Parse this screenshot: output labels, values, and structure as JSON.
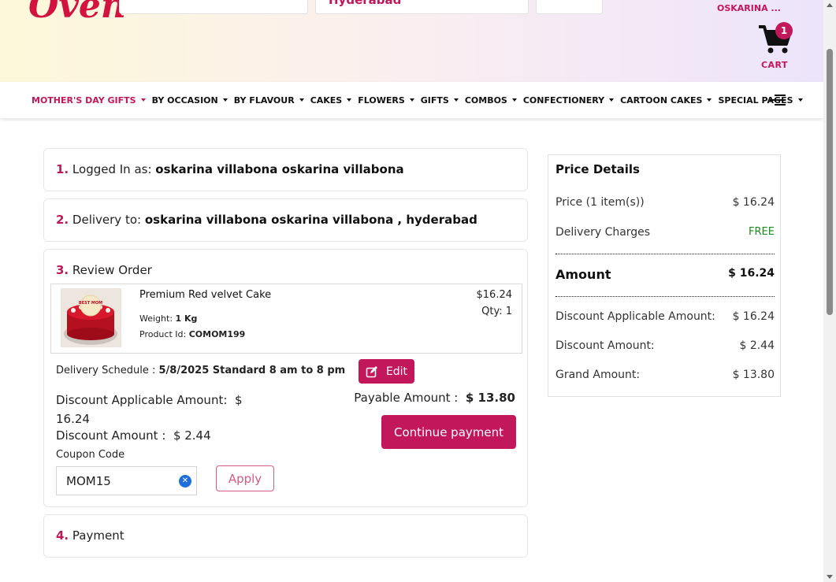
{
  "header": {
    "logo_text": "Oven",
    "location": "Hyderabad",
    "user_name": "OSKARINA ...",
    "cart_label": "CART",
    "cart_count": "1"
  },
  "nav": {
    "items": [
      {
        "label": "MOTHER'S DAY GIFTS"
      },
      {
        "label": "BY OCCASION"
      },
      {
        "label": "BY FLAVOUR"
      },
      {
        "label": "CAKES"
      },
      {
        "label": "FLOWERS"
      },
      {
        "label": "GIFTS"
      },
      {
        "label": "COMBOS"
      },
      {
        "label": "CONFECTIONERY"
      },
      {
        "label": "CARTOON CAKES"
      },
      {
        "label": "SPECIAL PAGES"
      }
    ]
  },
  "steps": {
    "login": {
      "num": "1.",
      "label": "Logged In as:",
      "value": "oskarina villabona oskarina villabona"
    },
    "delivery": {
      "num": "2.",
      "label": "Delivery to:",
      "value": "oskarina villabona oskarina villabona ,  hyderabad"
    },
    "review": {
      "num": "3.",
      "label": "Review Order"
    },
    "payment": {
      "num": "4.",
      "label": "Payment"
    }
  },
  "order": {
    "product_name": "Premium Red velvet Cake",
    "weight_label": "Weight:",
    "weight_value": "1 Kg",
    "product_id_label": "Product Id:",
    "product_id_value": "COMOM199",
    "price": "$16.24",
    "qty": "Qty: 1",
    "cake_topper_text": "BEST MOM",
    "delivery_label": "Delivery Schedule :",
    "delivery_value": "5/8/2025 Standard 8 am to 8 pm",
    "edit_label": "Edit",
    "discount_applicable_label": "Discount Applicable Amount:",
    "discount_applicable_value": "$ 16.24",
    "discount_amount_label": "Discount Amount :",
    "discount_amount_value": "$ 2.44",
    "payable_label": "Payable Amount :",
    "payable_value": "$ 13.80",
    "continue_label": "Continue payment",
    "coupon_label": "Coupon Code",
    "coupon_value": "MOM15",
    "apply_label": "Apply"
  },
  "price_details": {
    "title": "Price Details",
    "rows": [
      {
        "label": "Price (1 item(s))",
        "value": "$ 16.24"
      },
      {
        "label": "Delivery Charges",
        "value": "FREE"
      },
      {
        "label": "Amount",
        "value": "$ 16.24"
      },
      {
        "label": "Discount Applicable Amount:",
        "value": "$ 16.24"
      },
      {
        "label": "Discount Amount:",
        "value": "$ 2.44"
      },
      {
        "label": "Grand Amount:",
        "value": "$ 13.80"
      }
    ]
  },
  "colors": {
    "brand": "#c2185b",
    "free": "#1a8a1a",
    "clear_icon": "#1e6fd9"
  }
}
